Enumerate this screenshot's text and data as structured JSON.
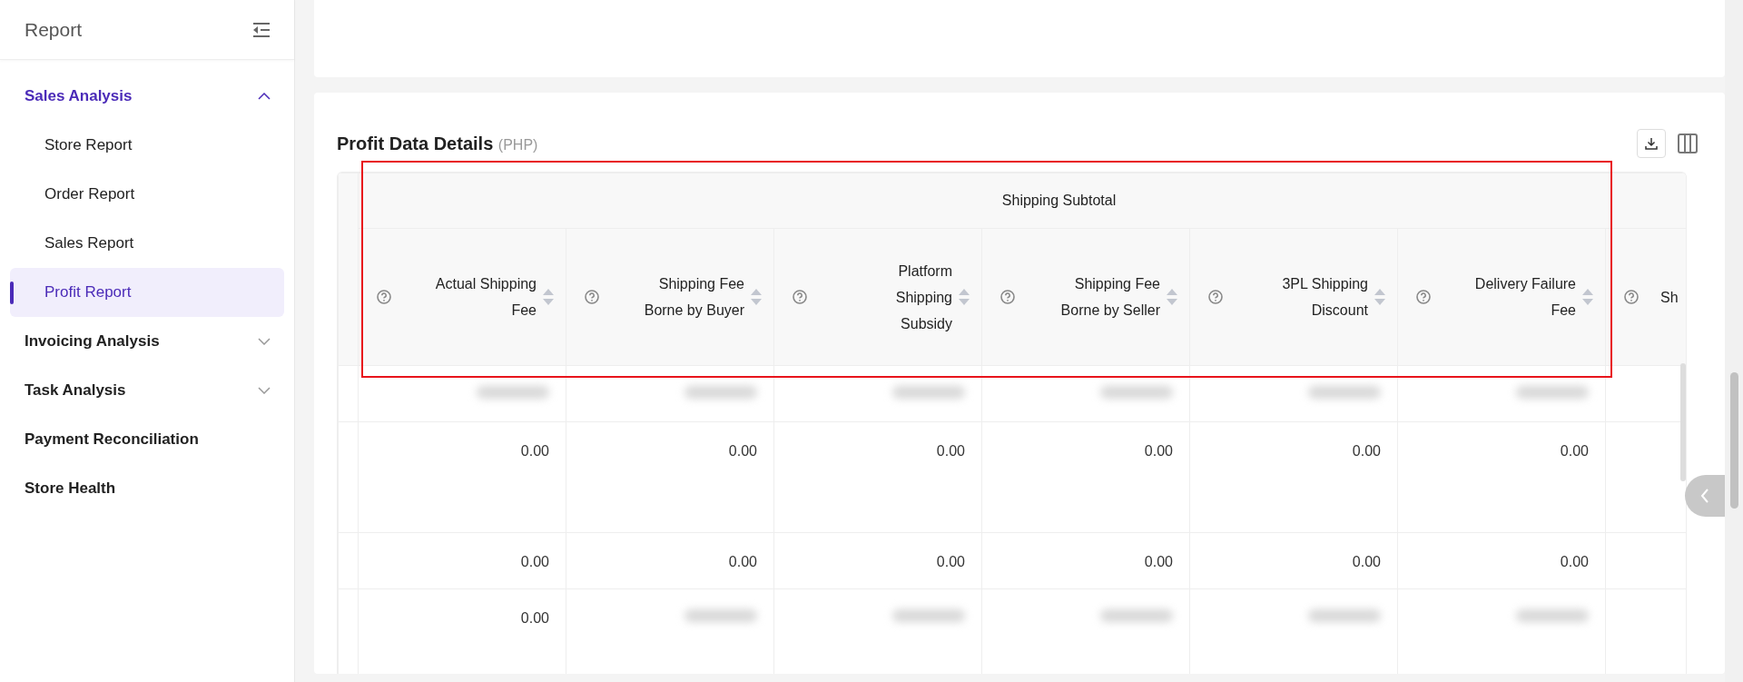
{
  "sidebar": {
    "title": "Report",
    "items": [
      {
        "label": "Sales Analysis",
        "kind": "group",
        "expanded": true,
        "children": [
          {
            "label": "Store Report",
            "selected": false
          },
          {
            "label": "Order Report",
            "selected": false
          },
          {
            "label": "Sales Report",
            "selected": false
          },
          {
            "label": "Profit Report",
            "selected": true
          }
        ]
      },
      {
        "label": "Invoicing Analysis",
        "kind": "group",
        "expanded": false
      },
      {
        "label": "Task Analysis",
        "kind": "group",
        "expanded": false
      },
      {
        "label": "Payment Reconciliation",
        "kind": "link",
        "selected": false
      },
      {
        "label": "Store Health",
        "kind": "link",
        "selected": false
      }
    ]
  },
  "report": {
    "title": "Profit Data Details",
    "unit": "(PHP)",
    "group_header": "Shipping Subtotal",
    "columns": [
      "Actual Shipping Fee",
      "Shipping Fee Borne by Buyer",
      "Platform Shipping Subsidy",
      "Shipping Fee Borne by Seller",
      "3PL Shipping Discount",
      "Delivery Failure Fee",
      "Sh"
    ],
    "rows": [
      {
        "cells": [
          {
            "kind": "blurred"
          },
          {
            "kind": "blurred"
          },
          {
            "kind": "blurred"
          },
          {
            "kind": "blurred"
          },
          {
            "kind": "blurred"
          },
          {
            "kind": "blurred"
          }
        ]
      },
      {
        "cells": [
          {
            "kind": "value",
            "text": "0.00"
          },
          {
            "kind": "value",
            "text": "0.00"
          },
          {
            "kind": "value",
            "text": "0.00"
          },
          {
            "kind": "value",
            "text": "0.00"
          },
          {
            "kind": "value",
            "text": "0.00"
          },
          {
            "kind": "value",
            "text": "0.00"
          }
        ]
      },
      {
        "cells": [
          {
            "kind": "value",
            "text": "0.00"
          },
          {
            "kind": "value",
            "text": "0.00"
          },
          {
            "kind": "value",
            "text": "0.00"
          },
          {
            "kind": "value",
            "text": "0.00"
          },
          {
            "kind": "value",
            "text": "0.00"
          },
          {
            "kind": "value",
            "text": "0.00"
          }
        ]
      },
      {
        "cells": [
          {
            "kind": "value",
            "text": "0.00"
          },
          {
            "kind": "blurred"
          },
          {
            "kind": "blurred"
          },
          {
            "kind": "blurred"
          },
          {
            "kind": "blurred"
          },
          {
            "kind": "blurred"
          }
        ]
      }
    ]
  },
  "annotation": {
    "kind": "frame"
  }
}
